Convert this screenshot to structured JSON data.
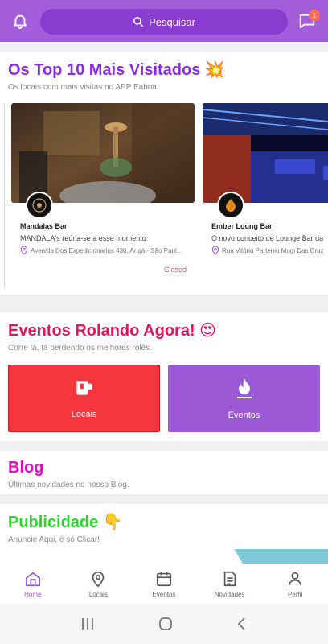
{
  "topbar": {
    "search_label": "Pesquisar",
    "chat_badge": "1",
    "bell_icon": "bell-icon",
    "chat_icon": "chat-bubble-icon",
    "accent": "#a45ddb"
  },
  "top10": {
    "title": "Os Top 10 Mais Visitados 💥",
    "subtitle": "Os locais com mais visitas no APP Eaboa",
    "title_color": "#8a2be2",
    "cards": [
      {
        "name": "Mandalas Bar",
        "description": "MANDALA's reúna-se a esse momento",
        "address": "Avenida Dos Expedicionarios 430, Arujá - São Paul...",
        "status": "Closed"
      },
      {
        "name": "Ember Loung Bar",
        "description": "O novo conceito de Lounge Bar da",
        "address": "Rua Vitório Partenio Mogi Das Cruz",
        "status": ""
      }
    ]
  },
  "events": {
    "title": "Eventos Rolando Agora! 😍",
    "subtitle": "Corre lá, tá perdendo os melhores rolês.",
    "title_color": "#e0155f",
    "locais_label": "Locais",
    "eventos_label": "Eventos",
    "locais_color": "#f5363f",
    "eventos_color": "#9b59d6"
  },
  "blog": {
    "title": "Blog",
    "subtitle": "Últimas novidades no nosso Blog.",
    "title_color": "#e00ec0"
  },
  "ads": {
    "title": "Publicidade 👇",
    "subtitle": "Anuncie Aqui, é só Clicar!",
    "title_color": "#22dd22"
  },
  "bottom_nav": {
    "items": [
      {
        "label": "Home",
        "icon": "home-icon",
        "active": true
      },
      {
        "label": "Locais",
        "icon": "map-pin-icon",
        "active": false
      },
      {
        "label": "Eventos",
        "icon": "calendar-icon",
        "active": false
      },
      {
        "label": "Novidades",
        "icon": "document-icon",
        "active": false
      },
      {
        "label": "Perfil",
        "icon": "user-icon",
        "active": false
      }
    ]
  }
}
